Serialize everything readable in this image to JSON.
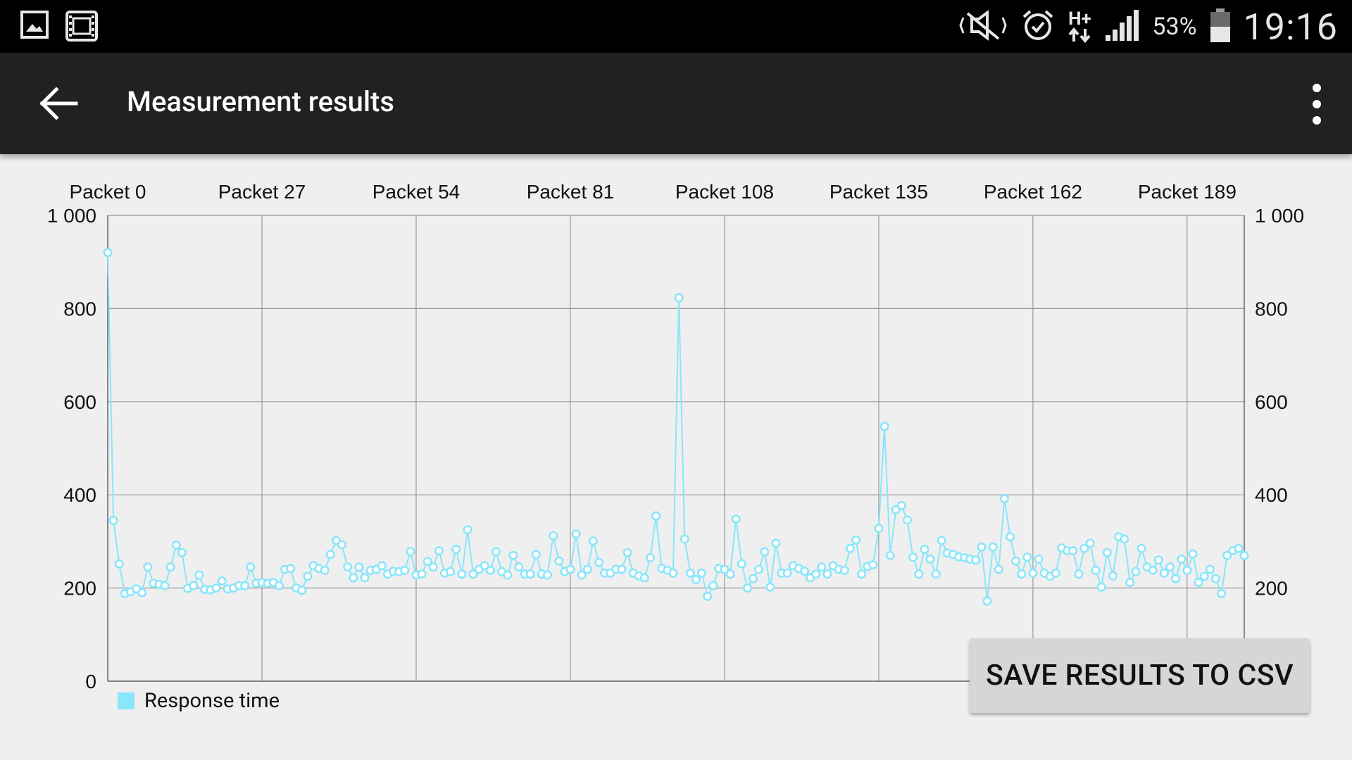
{
  "status_bar": {
    "battery": "53%",
    "time": "19:16",
    "network": "H+",
    "left_icons": [
      "gallery-icon",
      "film-icon"
    ],
    "right_icons": [
      "mute-icon",
      "alarm-icon",
      "network-icon",
      "signal-icon",
      "battery-icon"
    ]
  },
  "app_bar": {
    "title": "Measurement results",
    "back_icon": "arrow-back-icon",
    "menu_icon": "more-vert-icon"
  },
  "chart_data": {
    "type": "line",
    "title": "",
    "xlabel": "",
    "ylabel": "",
    "x_tick_labels": [
      "Packet 0",
      "Packet 27",
      "Packet 54",
      "Packet 81",
      "Packet 108",
      "Packet 135",
      "Packet 162",
      "Packet 189"
    ],
    "x_tick_values": [
      0,
      27,
      54,
      81,
      108,
      135,
      162,
      189
    ],
    "xlim": [
      0,
      199
    ],
    "ylim": [
      0,
      1000
    ],
    "y_tick_labels": [
      "0",
      "200",
      "400",
      "600",
      "800",
      "1 000"
    ],
    "y_tick_values": [
      0,
      200,
      400,
      600,
      800,
      1000
    ],
    "grid": true,
    "legend_position": "bottom-left",
    "series": [
      {
        "name": "Response time",
        "color": "#8ae6fa",
        "values": [
          920,
          345,
          252,
          188,
          192,
          198,
          190,
          245,
          210,
          208,
          205,
          245,
          292,
          276,
          199,
          205,
          228,
          197,
          196,
          200,
          215,
          198,
          200,
          205,
          205,
          245,
          210,
          212,
          210,
          212,
          205,
          240,
          242,
          200,
          195,
          225,
          248,
          242,
          238,
          272,
          302,
          293,
          245,
          222,
          245,
          222,
          238,
          240,
          248,
          230,
          236,
          235,
          238,
          278,
          228,
          230,
          257,
          245,
          280,
          232,
          235,
          283,
          230,
          325,
          230,
          240,
          248,
          238,
          278,
          235,
          228,
          270,
          245,
          230,
          230,
          272,
          230,
          228,
          312,
          258,
          235,
          240,
          316,
          228,
          240,
          301,
          255,
          232,
          232,
          240,
          240,
          276,
          232,
          226,
          222,
          265,
          355,
          242,
          238,
          232,
          823,
          305,
          232,
          218,
          232,
          182,
          205,
          242,
          240,
          230,
          348,
          252,
          200,
          220,
          240,
          278,
          202,
          296,
          232,
          232,
          248,
          242,
          236,
          222,
          230,
          245,
          230,
          248,
          240,
          238,
          285,
          303,
          230,
          246,
          250,
          328,
          547,
          270,
          368,
          377,
          346,
          266,
          230,
          283,
          262,
          230,
          302,
          275,
          272,
          267,
          265,
          262,
          260,
          288,
          172,
          288,
          240,
          392,
          310,
          258,
          230,
          266,
          232,
          262,
          232,
          225,
          232,
          286,
          280,
          280,
          230,
          285,
          296,
          238,
          202,
          276,
          226,
          310,
          305,
          212,
          235,
          285,
          245,
          238,
          260,
          232,
          245,
          220,
          262,
          238,
          273,
          212,
          225,
          240,
          220,
          188,
          270,
          280,
          285,
          270
        ]
      }
    ]
  },
  "save_button": {
    "label": "SAVE RESULTS TO CSV"
  }
}
